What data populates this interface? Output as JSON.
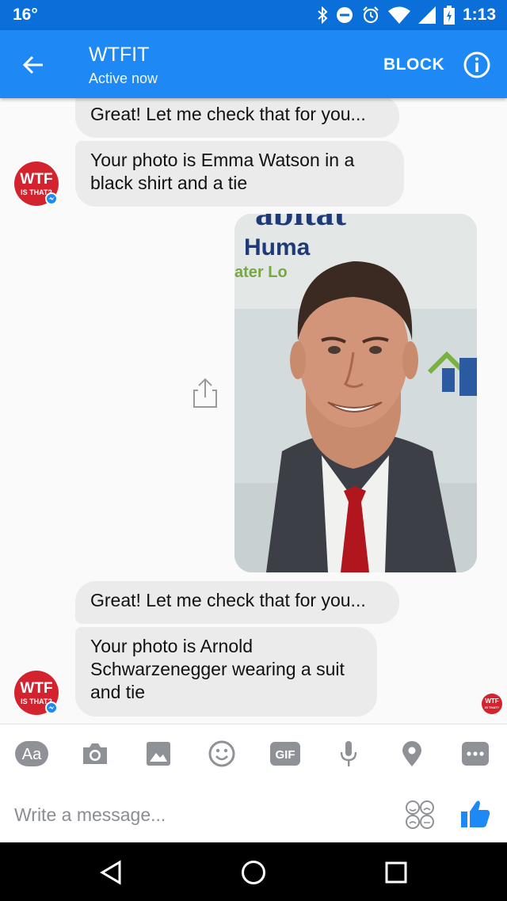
{
  "status_bar": {
    "temperature": "16°",
    "time": "1:13",
    "icons": [
      "bluetooth-icon",
      "do-not-disturb-icon",
      "alarm-icon",
      "wifi-icon",
      "cell-signal-icon",
      "battery-charging-icon"
    ]
  },
  "header": {
    "title": "WTFIT",
    "subtitle": "Active now",
    "block_label": "BLOCK",
    "back_icon": "arrow-left-icon",
    "info_icon": "info-icon",
    "color": "#1e88f5",
    "status_color": "#0a6fd8"
  },
  "bot": {
    "avatar_top": "WTF",
    "avatar_bottom": "IS THAT?",
    "avatar_color": "#d3232f"
  },
  "messages": [
    {
      "from": "bot",
      "text": "Great! Let me check that for you..."
    },
    {
      "from": "bot",
      "text": "Your photo is Emma Watson in a\nblack shirt and a tie"
    },
    {
      "from": "user",
      "type": "photo",
      "sign_text": [
        "abitat",
        "Huma",
        "ater Lo"
      ]
    },
    {
      "from": "bot",
      "text": "Great! Let me check that for you..."
    },
    {
      "from": "bot",
      "text": "Your photo is Arnold\nSchwarzenegger wearing a suit\nand tie"
    }
  ],
  "read_receipt": {
    "top": "WTF",
    "bottom": "IS THAT?"
  },
  "composer": {
    "tools": [
      {
        "name": "text-format-icon",
        "label": "Aa"
      },
      {
        "name": "camera-icon"
      },
      {
        "name": "gallery-icon"
      },
      {
        "name": "emoji-icon"
      },
      {
        "name": "gif-icon",
        "label": "GIF"
      },
      {
        "name": "microphone-icon"
      },
      {
        "name": "location-icon"
      },
      {
        "name": "more-icon"
      }
    ],
    "placeholder": "Write a message...",
    "like_color": "#1e88f5"
  },
  "nav": {
    "icons": [
      "back-triangle-icon",
      "home-circle-icon",
      "recents-square-icon"
    ]
  }
}
